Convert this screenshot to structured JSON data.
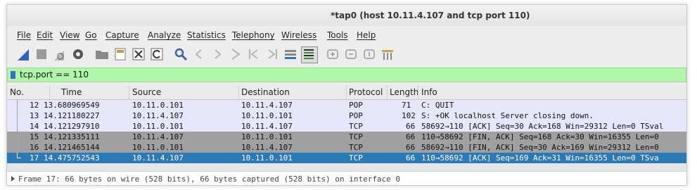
{
  "window": {
    "title": "*tap0 (host 10.11.4.107  and tcp port 110)"
  },
  "menu": [
    "File",
    "Edit",
    "View",
    "Go",
    "Capture",
    "Analyze",
    "Statistics",
    "Telephony",
    "Wireless",
    "Tools",
    "Help"
  ],
  "toolbar": [
    "shark-fin-start-icon",
    "stop-square-icon",
    "restart-icon",
    "capture-options-gear-icon",
    "open-folder-icon",
    "save-file-icon",
    "close-file-icon",
    "reload-icon",
    "find-magnifier-icon",
    "go-back-icon",
    "go-forward-icon",
    "go-to-packet-icon",
    "first-packet-icon",
    "last-packet-icon",
    "autoscroll-icon",
    "colorize-icon",
    "zoom-in-icon",
    "zoom-out-icon",
    "normal-size-icon",
    "resize-columns-icon"
  ],
  "filter": {
    "value": "tcp.port == 110"
  },
  "columns": {
    "no": "No.",
    "time": "Time",
    "source": "Source",
    "destination": "Destination",
    "protocol": "Protocol",
    "length": "Length",
    "info": "Info"
  },
  "packets": [
    {
      "no": "12",
      "time": "13.680969549",
      "source": "10.11.0.101",
      "destination": "10.11.4.107",
      "protocol": "POP",
      "length": "71",
      "info": "C: QUIT"
    },
    {
      "no": "13",
      "time": "14.121180227",
      "source": "10.11.4.107",
      "destination": "10.11.0.101",
      "protocol": "POP",
      "length": "102",
      "info": "S: +OK localhost Server closing down."
    },
    {
      "no": "14",
      "time": "14.121297910",
      "source": "10.11.0.101",
      "destination": "10.11.4.107",
      "protocol": "TCP",
      "length": "66",
      "info": "58692→110 [ACK] Seq=30 Ack=168 Win=29312 Len=0 TSval"
    },
    {
      "no": "15",
      "time": "14.121335111",
      "source": "10.11.4.107",
      "destination": "10.11.0.101",
      "protocol": "TCP",
      "length": "66",
      "info": "110→58692 [FIN, ACK] Seq=168 Ack=30 Win=16355 Len=0"
    },
    {
      "no": "16",
      "time": "14.121465144",
      "source": "10.11.0.101",
      "destination": "10.11.4.107",
      "protocol": "TCP",
      "length": "66",
      "info": "58692→110 [FIN, ACK] Seq=30 Ack=169 Win=29312 Len=0"
    },
    {
      "no": "17",
      "time": "14.475752543",
      "source": "10.11.4.107",
      "destination": "10.11.0.101",
      "protocol": "TCP",
      "length": "66",
      "info": "110→58692 [ACK] Seq=169 Ack=31 Win=16355 Len=0 TSva"
    }
  ],
  "detail": {
    "frame": "Frame 17: 66 bytes on wire (528 bits), 66 bytes captured (528 bits) on interface 0"
  },
  "colors": {
    "filter_bg": "#b0f7a9",
    "row_pop": "#e6e6fa",
    "row_tcp": "#e7e6ff",
    "row_fin": "#a0a0a0",
    "row_selected": "#2a7ab8"
  }
}
